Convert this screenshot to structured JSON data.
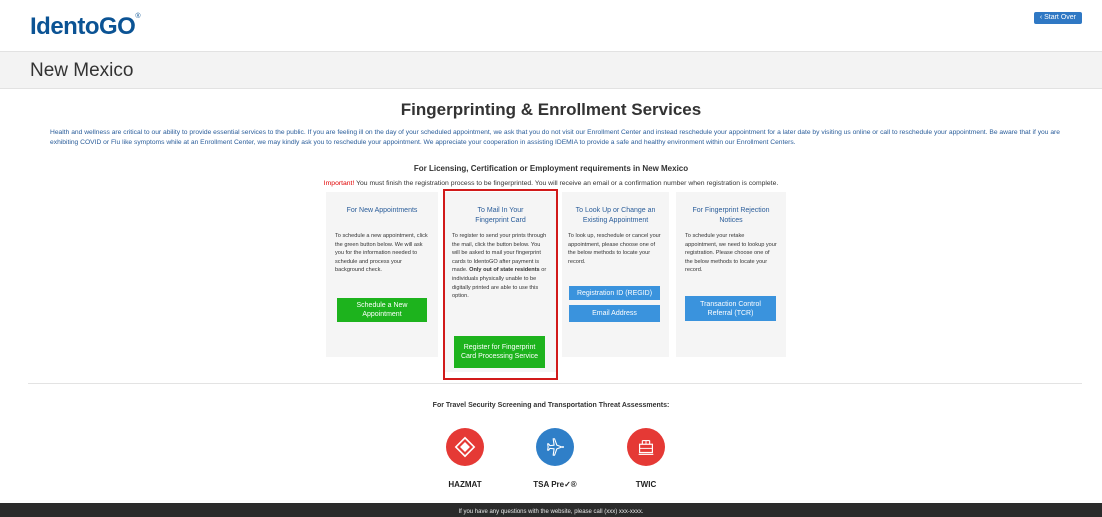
{
  "header": {
    "logo_text": "IdentoGO",
    "logo_mark": "®",
    "start_over_label": "‹ Start Over"
  },
  "state": {
    "title": "New Mexico"
  },
  "main": {
    "title": "Fingerprinting & Enrollment Services",
    "notice": "Health and wellness are critical to our ability to provide essential services to the public. If you are feeling ill on the day of your scheduled appointment, we ask that you do not visit our Enrollment Center and instead reschedule your appointment for a later date by visiting us online or call to reschedule your appointment. Be aware that if you are exhibiting COVID or Flu like symptoms while at an Enrollment Center, we may kindly ask you to reschedule your appointment. We appreciate your cooperation in assisting IDEMIA to provide a safe and healthy environment within our Enrollment Centers.",
    "subtitle": "For Licensing, Certification or Employment requirements in New Mexico",
    "important_label": "Important!",
    "important_text": " You must finish the registration process to be fingerprinted. You will receive an email or a confirmation number when registration is complete."
  },
  "cards": [
    {
      "title": "For New Appointments",
      "text": "To schedule a new appointment, click the green button below. We will ask you for the information needed to schedule and process your background check.",
      "buttons": [
        {
          "label": "Schedule a New Appointment"
        }
      ]
    },
    {
      "title": "To Mail In Your Fingerprint Card",
      "text_before": "To register to send your prints through the mail, click the button below. You will be asked to mail your fingerprint cards to IdentoGO after payment is made. ",
      "text_bold": "Only out of state residents",
      "text_after": " or individuals physically unable to be digitally printed are able to use this option.",
      "buttons": [
        {
          "label": "Register for Fingerprint Card Processing Service"
        }
      ]
    },
    {
      "title": "To Look Up or Change an Existing Appointment",
      "text": "To look up, reschedule or cancel your appointment, please choose one of the below methods to locate your record.",
      "buttons": [
        {
          "label": "Registration ID (REGID)"
        },
        {
          "label": "Email Address"
        }
      ]
    },
    {
      "title": "For Fingerprint Rejection Notices",
      "text": "To schedule your retake appointment, we need to lookup your registration. Please choose one of the below methods to locate your record.",
      "buttons": [
        {
          "label": "Transaction Control Referral (TCR)"
        }
      ]
    }
  ],
  "travel": {
    "title": "For Travel Security Screening and Transportation Threat Assessments:",
    "items": [
      {
        "label": "HAZMAT",
        "icon": "hazmat-icon",
        "color": "#e53935"
      },
      {
        "label": "TSA Pre✓®",
        "icon": "airplane-icon",
        "color": "#2f7fc8"
      },
      {
        "label": "TWIC",
        "icon": "twic-icon",
        "color": "#e53935"
      }
    ]
  },
  "footer": {
    "text": "If you have any questions with the website, please call (xxx) xxx-xxxx."
  },
  "colors": {
    "brand_blue": "#0b5394",
    "green_button": "#1db31d",
    "blue_button": "#3a93dd",
    "highlight_red": "#d11a1a",
    "footer_bg": "#2b2b2b"
  }
}
